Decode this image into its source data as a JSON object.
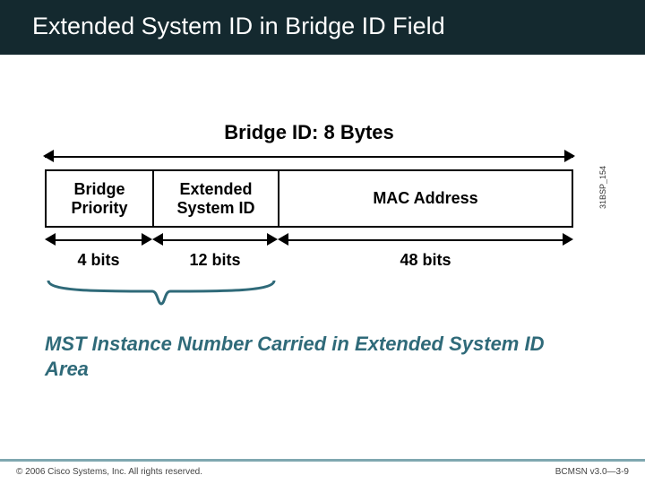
{
  "header": {
    "title": "Extended System ID in Bridge ID Field"
  },
  "diagram": {
    "total_label": "Bridge ID: 8 Bytes",
    "fields": [
      {
        "name": "Bridge Priority",
        "bits": "4 bits"
      },
      {
        "name": "Extended System ID",
        "bits": "12 bits"
      },
      {
        "name": "MAC Address",
        "bits": "48 bits"
      }
    ],
    "mst_note": "MST Instance Number Carried in Extended System ID Area",
    "side_code": "31BSP_154"
  },
  "footer": {
    "copyright": "© 2006 Cisco Systems, Inc. All rights reserved.",
    "course_ref": "BCMSN v3.0—3-9"
  }
}
